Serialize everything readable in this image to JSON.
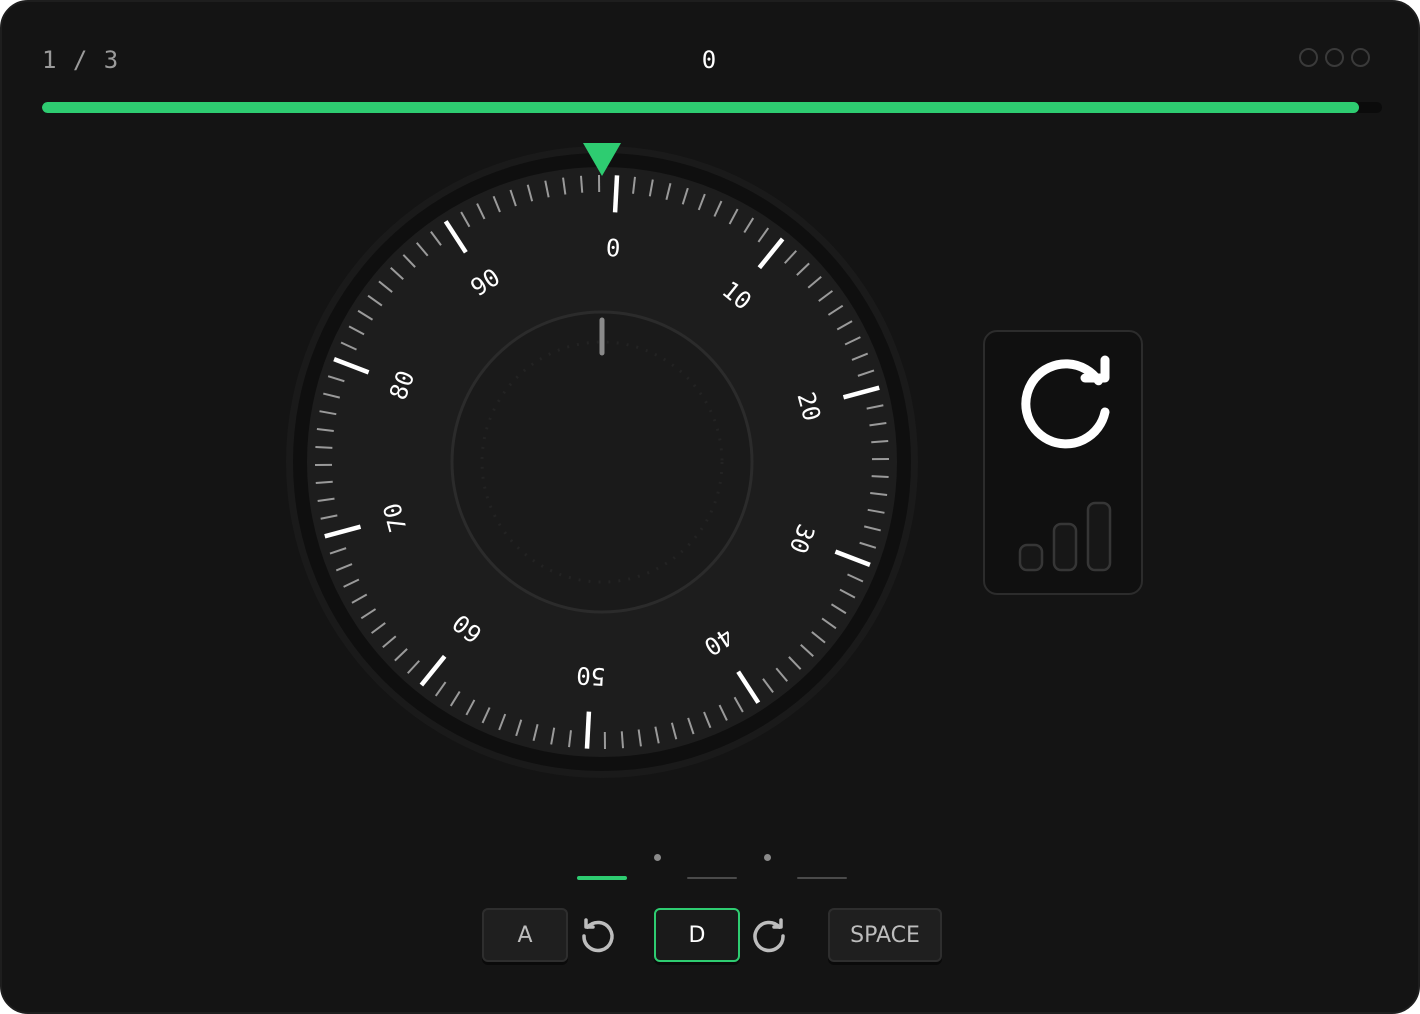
{
  "header": {
    "stage_counter": "1 / 3",
    "current_reading": "0",
    "menu_dots": [
      "menu-dot-1",
      "menu-dot-2",
      "menu-dot-3"
    ]
  },
  "progress": {
    "fraction": 0.983,
    "color": "#2ecc71"
  },
  "dial": {
    "current_value": 0,
    "total_ticks": 100,
    "labels": [
      "0",
      "10",
      "20",
      "30",
      "40",
      "50",
      "60",
      "70",
      "80",
      "90"
    ],
    "pointer_color": "#2ecc71"
  },
  "reset_card": {
    "icon": "reset-icon",
    "secondary_icon": "signal-bars-icon"
  },
  "combination_steps": [
    {
      "state": "active"
    },
    {
      "state": "pending"
    },
    {
      "state": "pending"
    }
  ],
  "controls": {
    "left_key": "A",
    "left_icon": "rotate-counterclockwise-icon",
    "right_key": "D",
    "right_icon": "rotate-clockwise-icon",
    "confirm_key": "SPACE"
  },
  "colors": {
    "accent": "#2ecc71",
    "background": "#141414"
  }
}
